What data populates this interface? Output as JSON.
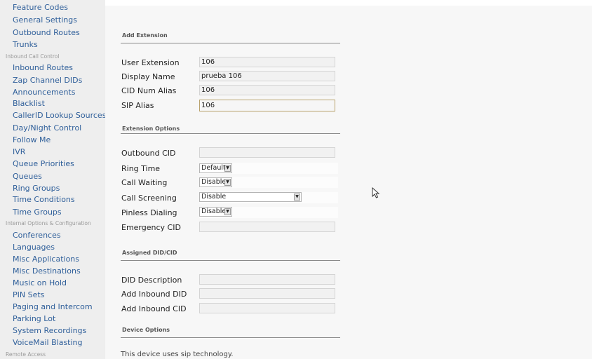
{
  "sidebar": {
    "items_top": [
      {
        "label": "Feature Codes"
      },
      {
        "label": "General Settings"
      },
      {
        "label": "Outbound Routes"
      },
      {
        "label": "Trunks"
      }
    ],
    "section_inbound": "Inbound Call Control",
    "items_inbound": [
      {
        "label": "Inbound Routes"
      },
      {
        "label": "Zap Channel DIDs"
      },
      {
        "label": "Announcements"
      },
      {
        "label": "Blacklist"
      },
      {
        "label": "CallerID Lookup Sources"
      },
      {
        "label": "Day/Night Control"
      },
      {
        "label": "Follow Me"
      },
      {
        "label": "IVR"
      },
      {
        "label": "Queue Priorities"
      },
      {
        "label": "Queues"
      },
      {
        "label": "Ring Groups"
      },
      {
        "label": "Time Conditions"
      },
      {
        "label": "Time Groups"
      }
    ],
    "section_internal": "Internal Options & Configuration",
    "items_internal": [
      {
        "label": "Conferences"
      },
      {
        "label": "Languages"
      },
      {
        "label": "Misc Applications"
      },
      {
        "label": "Misc Destinations"
      },
      {
        "label": "Music on Hold"
      },
      {
        "label": "PIN Sets"
      },
      {
        "label": "Paging and Intercom"
      },
      {
        "label": "Parking Lot"
      },
      {
        "label": "System Recordings"
      },
      {
        "label": "VoiceMail Blasting"
      }
    ],
    "section_remote": "Remote Access"
  },
  "form": {
    "add_extension": {
      "title": "Add Extension",
      "user_extension": {
        "label": "User Extension",
        "value": "106"
      },
      "display_name": {
        "label": "Display Name",
        "value": "prueba 106"
      },
      "cid_num_alias": {
        "label": "CID Num Alias",
        "value": "106"
      },
      "sip_alias": {
        "label": "SIP Alias",
        "value": "106"
      }
    },
    "extension_options": {
      "title": "Extension Options",
      "outbound_cid": {
        "label": "Outbound CID",
        "value": ""
      },
      "ring_time": {
        "label": "Ring Time",
        "value": "Default"
      },
      "call_waiting": {
        "label": "Call Waiting",
        "value": "Disable"
      },
      "call_screening": {
        "label": "Call Screening",
        "value": "Disable"
      },
      "pinless_dialing": {
        "label": "Pinless Dialing",
        "value": "Disable"
      },
      "emergency_cid": {
        "label": "Emergency CID",
        "value": ""
      }
    },
    "assigned_did": {
      "title": "Assigned DID/CID",
      "did_description": {
        "label": "DID Description",
        "value": ""
      },
      "add_inbound_did": {
        "label": "Add Inbound DID",
        "value": ""
      },
      "add_inbound_cid": {
        "label": "Add Inbound CID",
        "value": ""
      }
    },
    "device_options": {
      "title": "Device Options",
      "technology_note": "This device uses sip technology."
    }
  },
  "colors": {
    "link": "#2f5f9a",
    "sidebar_bg": "#eeeeee",
    "main_bg": "#f7f7f7",
    "focus_border": "#b9a36e"
  },
  "icons": {
    "dropdown": "chevron-down-icon",
    "cursor": "mouse-pointer-icon"
  }
}
